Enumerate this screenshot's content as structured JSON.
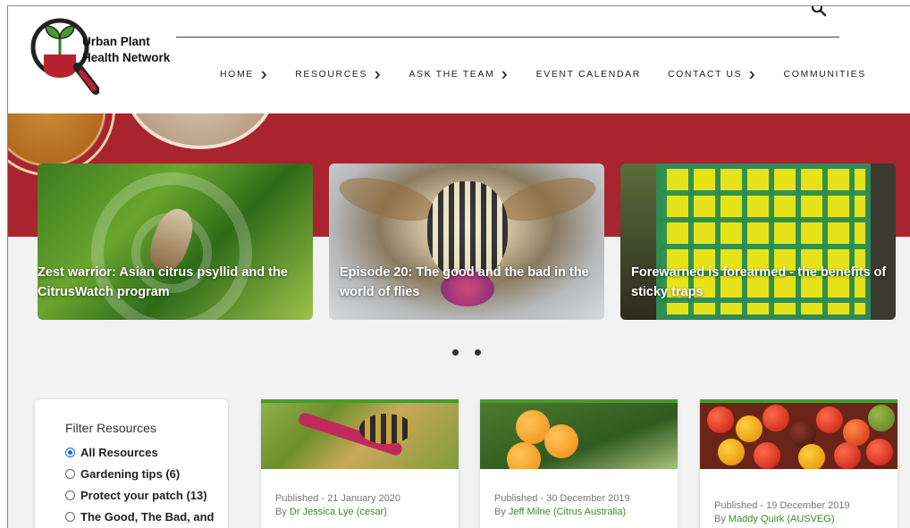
{
  "brand": {
    "name_line1": "Urban Plant",
    "name_line2": "Health Network",
    "colors": {
      "red": "#a8242e",
      "green": "#4a9a2c",
      "radio_blue": "#1a66d6"
    }
  },
  "header": {
    "search_icon": "search-icon"
  },
  "nav": [
    {
      "label": "HOME",
      "dropdown": true
    },
    {
      "label": "RESOURCES",
      "dropdown": true
    },
    {
      "label": "ASK THE TEAM",
      "dropdown": true
    },
    {
      "label": "EVENT CALENDAR",
      "dropdown": false
    },
    {
      "label": "CONTACT US",
      "dropdown": true
    },
    {
      "label": "COMMUNITIES",
      "dropdown": false
    }
  ],
  "slides": [
    {
      "title": "Zest warrior: Asian citrus psyllid and the CitrusWatch program"
    },
    {
      "title": "Episode 20: The good and the bad in the world of flies"
    },
    {
      "title": "Forewarned is forearmed - the benefits of sticky traps"
    }
  ],
  "filter": {
    "title": "Filter Resources",
    "options": [
      {
        "label": "All Resources",
        "checked": true
      },
      {
        "label": "Gardening tips (6)",
        "checked": false
      },
      {
        "label": "Protect your patch (13)",
        "checked": false
      },
      {
        "label": "The Good, The Bad, and",
        "checked": false
      }
    ]
  },
  "cards": [
    {
      "published": "Published - 21 January 2020",
      "by": "By ",
      "author": "Dr Jessica Lye (cesar)"
    },
    {
      "published": "Published - 30 December 2019",
      "by": "By ",
      "author": "Jeff Milne (Citrus Australia)"
    },
    {
      "published": "Published - 19 December 2019",
      "by": "By ",
      "author": "Maddy Quirk (AUSVEG)"
    }
  ]
}
